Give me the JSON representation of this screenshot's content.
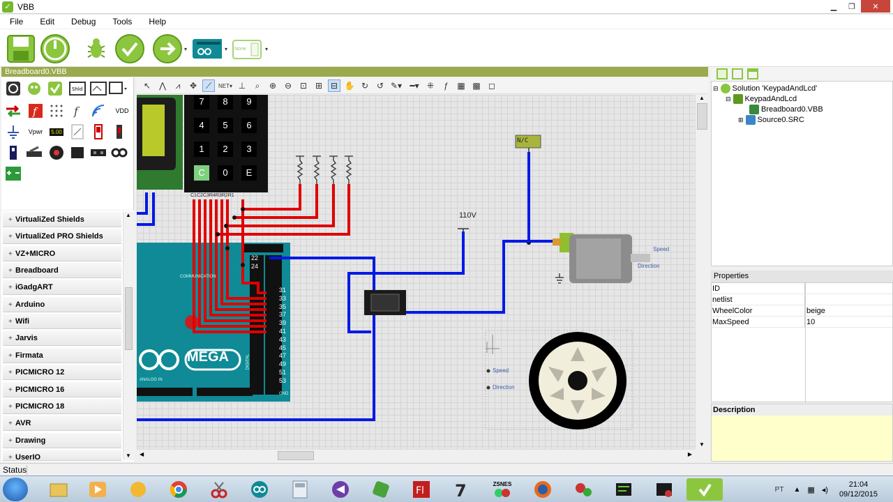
{
  "window": {
    "title": "VBB",
    "icon": "vbb-logo-icon"
  },
  "menu": [
    "File",
    "Edit",
    "Debug",
    "Tools",
    "Help"
  ],
  "main_toolbar": {
    "buttons": [
      "save-icon",
      "power-icon",
      "bug-icon",
      "check-icon",
      "run-arrow-icon",
      "arduino-board-icon",
      "none-board-icon"
    ],
    "board_label": "None"
  },
  "document": {
    "tab_title": "Breadboard0.VBB"
  },
  "palette": {
    "labels": {
      "vpwr": "Vpwr",
      "vdd": "VDD",
      "display_value": "5.00"
    }
  },
  "categories": [
    "VirtualiZed Shields",
    "VirtualiZed PRO Shields",
    "VZ+MICRO",
    "Breadboard",
    "iGadgART",
    "Arduino",
    "Wifi",
    "Jarvis",
    "Firmata",
    "PICMICRO 12",
    "PICMICRO 16",
    "PICMICRO 18",
    "AVR",
    "Drawing",
    "UserIO"
  ],
  "canvas": {
    "keypad_keys": [
      "7",
      "8",
      "9",
      "4",
      "5",
      "6",
      "1",
      "2",
      "3",
      "C",
      "0",
      "E"
    ],
    "keypad_pins_label": "C1C2C3R4R3R2R1",
    "arduino_logo_text": "MEGA",
    "arduino_pin_numbers_left": [
      "22",
      "24"
    ],
    "arduino_pin_numbers_right": [
      "31",
      "33",
      "35",
      "37",
      "39",
      "41",
      "43",
      "45",
      "47",
      "49",
      "51",
      "53"
    ],
    "arduino_small_labels": {
      "communication": "COMMUNICATION",
      "digital": "DIGITAL",
      "analog": "ANALOG IN",
      "gnd": "GND"
    },
    "nc_box_label": "N/C",
    "voltage_label": "110V",
    "motor_port_speed": "Speed",
    "motor_port_direction": "Direction",
    "wheel_port_speed": "Speed",
    "wheel_port_direction": "Direction"
  },
  "solution_tree": {
    "solution": "Solution 'KeypadAndLcd'",
    "project": "KeypadAndLcd",
    "files": [
      "Breadboard0.VBB",
      "Source0.SRC"
    ]
  },
  "properties": {
    "header": "Properties",
    "rows": [
      {
        "key": "ID",
        "value": ""
      },
      {
        "key": "netlist",
        "value": ""
      },
      {
        "key": "WheelColor",
        "value": "beige"
      },
      {
        "key": "MaxSpeed",
        "value": "10"
      }
    ]
  },
  "description": {
    "title": "Description"
  },
  "status": {
    "text": "Status"
  },
  "taskbar": {
    "apps": [
      "start-orb-icon",
      "file-explorer-icon",
      "media-player-icon",
      "folder-icon",
      "chrome-icon",
      "snipping-icon",
      "arduino-ide-icon",
      "calculator-icon",
      "visual-studio-icon",
      "green-app-icon",
      "flash-icon",
      "7zip-icon",
      "zsnes-icon",
      "firefox-icon",
      "gears-icon",
      "pcb-icon",
      "pcb-edit-icon",
      "vbb-task-icon"
    ],
    "zsnes_label": "ZSNES",
    "language": "PT",
    "time": "21:04",
    "date": "09/12/2015"
  },
  "colors": {
    "accent_green": "#76b82a",
    "doc_tab": "#9aaa4c",
    "wire_red": "#e00000",
    "wire_blue": "#0019e6",
    "arduino_teal": "#0f8a96",
    "wheel_beige": "#f2eedc"
  }
}
